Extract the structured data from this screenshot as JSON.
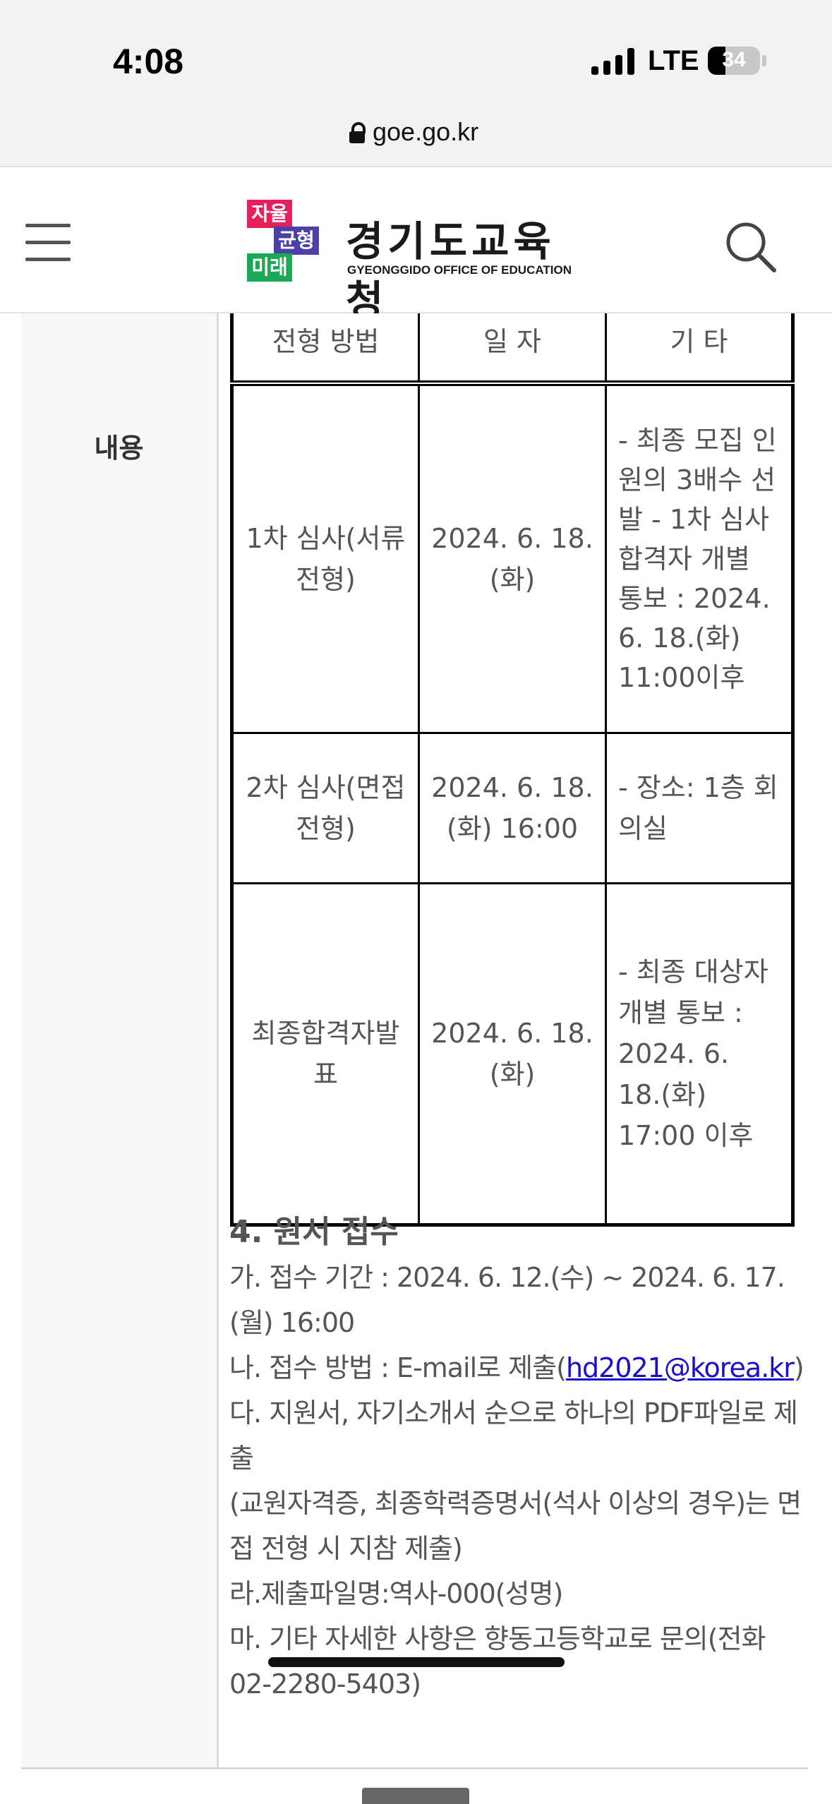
{
  "status_bar": {
    "time": "4:08",
    "network": "LTE",
    "battery": "34"
  },
  "browser": {
    "url": "goe.go.kr"
  },
  "header": {
    "badges": [
      "자율",
      "균형",
      "미래"
    ],
    "logo_title": "경기도교육청",
    "logo_subtitle": "GYEONGGIDO OFFICE OF EDUCATION",
    "colors": {
      "badge1": "#e6205b",
      "badge2": "#4b3fa8",
      "badge3": "#1aaa55"
    }
  },
  "content": {
    "row_label": "내용",
    "table": {
      "headers": [
        "전형 방법",
        "일 자",
        "기 타"
      ],
      "rows": [
        [
          "1차 심사(서류전형)",
          "2024. 6. 18.(화)",
          "- 최종 모집 인원의 3배수 선발 - 1차 심사 합격자 개별 통보 : 2024. 6. 18.(화) 11:00이후"
        ],
        [
          "2차 심사(면접전형)",
          "2024. 6. 18.(화) 16:00",
          "- 장소: 1층 회의실"
        ],
        [
          "최종합격자발표",
          "2024. 6. 18.(화)",
          "- 최종 대상자 개별 통보 : 2024. 6. 18.(화) 17:00 이후"
        ]
      ]
    },
    "section4": {
      "title": "4. 원서 접수",
      "line_ga": "가. 접수 기간 : 2024. 6. 12.(수) ~ 2024. 6. 17.(월) 16:00",
      "line_na_prefix": "나. 접수 방법 : E-mail로 제출(",
      "line_na_email": "hd2021@korea.kr",
      "line_na_suffix": ")",
      "line_da": "다. 지원서, 자기소개서 순으로 하나의 PDF파일로 제출",
      "line_da_note": "(교원자격증, 최종학력증명서(석사 이상의 경우)는 면접 전형 시 지참 제출)",
      "line_ra": "라.제출파일명:역사-000(성명)",
      "line_ma": "마. 기타 자세한 사항은 향동고등학교로 문의(전화 02-2280-5403)"
    }
  }
}
